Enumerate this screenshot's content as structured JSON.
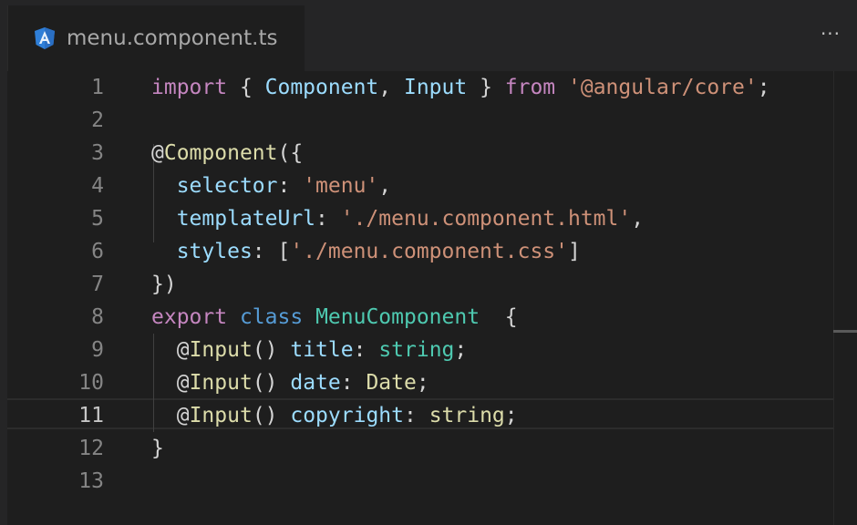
{
  "tab": {
    "filename": "menu.component.ts",
    "icon": "angular-icon",
    "more_label": "···"
  },
  "editor": {
    "active_line": 11,
    "lines": [
      {
        "n": "1",
        "tokens": [
          [
            "kw",
            "import"
          ],
          [
            "pn",
            " { "
          ],
          [
            "prop",
            "Component"
          ],
          [
            "pn",
            ", "
          ],
          [
            "prop",
            "Input"
          ],
          [
            "pn",
            " } "
          ],
          [
            "kw",
            "from"
          ],
          [
            "pn",
            " "
          ],
          [
            "str",
            "'@angular/core'"
          ],
          [
            "pn",
            ";"
          ]
        ]
      },
      {
        "n": "2",
        "tokens": []
      },
      {
        "n": "3",
        "tokens": [
          [
            "at",
            "@"
          ],
          [
            "fn",
            "Component"
          ],
          [
            "pn",
            "({"
          ]
        ]
      },
      {
        "n": "4",
        "tokens": [
          [
            "pn",
            "  "
          ],
          [
            "prop",
            "selector"
          ],
          [
            "pn",
            ": "
          ],
          [
            "str",
            "'menu'"
          ],
          [
            "pn",
            ","
          ]
        ]
      },
      {
        "n": "5",
        "tokens": [
          [
            "pn",
            "  "
          ],
          [
            "prop",
            "templateUrl"
          ],
          [
            "pn",
            ": "
          ],
          [
            "str",
            "'./menu.component.html'"
          ],
          [
            "pn",
            ","
          ]
        ]
      },
      {
        "n": "6",
        "tokens": [
          [
            "pn",
            "  "
          ],
          [
            "prop",
            "styles"
          ],
          [
            "pn",
            ": ["
          ],
          [
            "str",
            "'./menu.component.css'"
          ],
          [
            "pn",
            "]"
          ]
        ]
      },
      {
        "n": "7",
        "tokens": [
          [
            "pn",
            "})"
          ]
        ]
      },
      {
        "n": "8",
        "tokens": [
          [
            "kw",
            "export"
          ],
          [
            "pn",
            " "
          ],
          [
            "kwb",
            "class"
          ],
          [
            "pn",
            " "
          ],
          [
            "cls",
            "MenuComponent"
          ],
          [
            "pn",
            "  {"
          ]
        ]
      },
      {
        "n": "9",
        "tokens": [
          [
            "pn",
            "  "
          ],
          [
            "at",
            "@"
          ],
          [
            "fn",
            "Input"
          ],
          [
            "pn",
            "() "
          ],
          [
            "prop",
            "title"
          ],
          [
            "pn",
            ": "
          ],
          [
            "typ",
            "string"
          ],
          [
            "pn",
            ";"
          ]
        ]
      },
      {
        "n": "10",
        "tokens": [
          [
            "pn",
            "  "
          ],
          [
            "at",
            "@"
          ],
          [
            "fn",
            "Input"
          ],
          [
            "pn",
            "() "
          ],
          [
            "prop",
            "date"
          ],
          [
            "pn",
            ": "
          ],
          [
            "fn",
            "Date"
          ],
          [
            "pn",
            ";"
          ]
        ]
      },
      {
        "n": "11",
        "tokens": [
          [
            "pn",
            "  "
          ],
          [
            "at",
            "@"
          ],
          [
            "fn",
            "Input"
          ],
          [
            "pn",
            "() "
          ],
          [
            "prop",
            "copyright"
          ],
          [
            "pn",
            ": "
          ],
          [
            "fn",
            "string"
          ],
          [
            "pn",
            ";"
          ]
        ]
      },
      {
        "n": "12",
        "tokens": [
          [
            "pn",
            "}"
          ]
        ]
      },
      {
        "n": "13",
        "tokens": []
      }
    ]
  }
}
